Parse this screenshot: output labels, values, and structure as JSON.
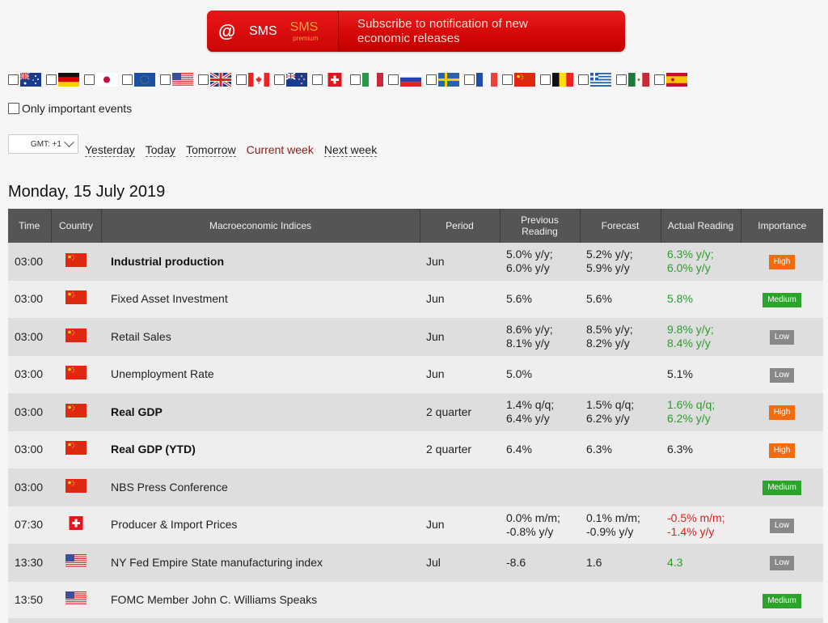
{
  "banner": {
    "email_icon": "@",
    "sms_label": "SMS",
    "sms_premium_label": "SMS",
    "sms_premium_sub": "premium",
    "text_line1": "Subscribe to notification of new",
    "text_line2": "economic releases"
  },
  "countries": [
    {
      "code": "au",
      "name": "Australia"
    },
    {
      "code": "de",
      "name": "Germany"
    },
    {
      "code": "jp",
      "name": "Japan"
    },
    {
      "code": "eu",
      "name": "European Union"
    },
    {
      "code": "us",
      "name": "United States"
    },
    {
      "code": "gb",
      "name": "United Kingdom"
    },
    {
      "code": "ca",
      "name": "Canada"
    },
    {
      "code": "nz",
      "name": "New Zealand"
    },
    {
      "code": "ch",
      "name": "Switzerland"
    },
    {
      "code": "it",
      "name": "Italy"
    },
    {
      "code": "ru",
      "name": "Russia"
    },
    {
      "code": "se",
      "name": "Sweden"
    },
    {
      "code": "fr",
      "name": "France"
    },
    {
      "code": "cn",
      "name": "China"
    },
    {
      "code": "be",
      "name": "Belgium"
    },
    {
      "code": "gr",
      "name": "Greece"
    },
    {
      "code": "mx",
      "name": "Mexico"
    },
    {
      "code": "es",
      "name": "Spain"
    }
  ],
  "filters": {
    "only_important_label": "Only important events"
  },
  "timezone": {
    "selected": "GMT: +1"
  },
  "nav": {
    "yesterday": "Yesterday",
    "today": "Today",
    "tomorrow": "Tomorrow",
    "current_week": "Current week",
    "next_week": "Next week"
  },
  "date_heading": "Monday, 15 July 2019",
  "table": {
    "headers": {
      "time": "Time",
      "country": "Country",
      "indices": "Macroeconomic Indices",
      "period": "Period",
      "previous_1": "Previous",
      "previous_2": "Reading",
      "forecast": "Forecast",
      "actual": "Actual Reading",
      "importance": "Importance"
    },
    "rows": [
      {
        "time": "03:00",
        "country": "cn",
        "event": "Industrial production",
        "bold": true,
        "period": "Jun",
        "prev": [
          "5.0% y/y;",
          "6.0% y/y"
        ],
        "forecast": [
          "5.2% y/y;",
          "5.9% y/y"
        ],
        "actual": [
          "6.3% y/y;",
          "6.0% y/y"
        ],
        "actual_color": "green",
        "importance": "High"
      },
      {
        "time": "03:00",
        "country": "cn",
        "event": "Fixed Asset Investment",
        "bold": false,
        "period": "Jun",
        "prev": [
          "5.6%"
        ],
        "forecast": [
          "5.6%"
        ],
        "actual": [
          "5.8%"
        ],
        "actual_color": "green",
        "importance": "Medium"
      },
      {
        "time": "03:00",
        "country": "cn",
        "event": "Retail Sales",
        "bold": false,
        "period": "Jun",
        "prev": [
          "8.6% y/y;",
          "8.1% y/y"
        ],
        "forecast": [
          "8.5% y/y;",
          "8.2% y/y"
        ],
        "actual": [
          "9.8% y/y;",
          "8.4% y/y"
        ],
        "actual_color": "green",
        "importance": "Low"
      },
      {
        "time": "03:00",
        "country": "cn",
        "event": "Unemployment Rate",
        "bold": false,
        "period": "Jun",
        "prev": [
          "5.0%"
        ],
        "forecast": [],
        "actual": [
          "5.1%"
        ],
        "actual_color": "neutral",
        "importance": "Low"
      },
      {
        "time": "03:00",
        "country": "cn",
        "event": "Real GDP",
        "bold": true,
        "period": "2 quarter",
        "prev": [
          "1.4% q/q;",
          "6.4% y/y"
        ],
        "forecast": [
          "1.5% q/q;",
          "6.2% y/y"
        ],
        "actual": [
          "1.6% q/q;",
          "6.2% y/y"
        ],
        "actual_color": "green",
        "importance": "High"
      },
      {
        "time": "03:00",
        "country": "cn",
        "event": "Real GDP (YTD)",
        "bold": true,
        "period": "2 quarter",
        "prev": [
          "6.4%"
        ],
        "forecast": [
          "6.3%"
        ],
        "actual": [
          "6.3%"
        ],
        "actual_color": "neutral",
        "importance": "High"
      },
      {
        "time": "03:00",
        "country": "cn",
        "event": "NBS Press Conference",
        "bold": false,
        "period": "",
        "prev": [],
        "forecast": [],
        "actual": [],
        "actual_color": "neutral",
        "importance": "Medium"
      },
      {
        "time": "07:30",
        "country": "ch",
        "event": "Producer & Import Prices",
        "bold": false,
        "period": "Jun",
        "prev": [
          "0.0% m/m;",
          "-0.8% y/y"
        ],
        "forecast": [
          "0.1% m/m;",
          "-0.9% y/y"
        ],
        "actual": [
          "-0.5% m/m;",
          "-1.4% y/y"
        ],
        "actual_color": "red",
        "importance": "Low"
      },
      {
        "time": "13:30",
        "country": "us",
        "event": "NY Fed Empire State manufacturing index",
        "bold": false,
        "period": "Jul",
        "prev": [
          "-8.6"
        ],
        "forecast": [
          "1.6"
        ],
        "actual": [
          "4.3"
        ],
        "actual_color": "green",
        "importance": "Low"
      },
      {
        "time": "13:50",
        "country": "us",
        "event": "FOMC Member John C. Williams Speaks",
        "bold": false,
        "period": "",
        "prev": [],
        "forecast": [],
        "actual": [],
        "actual_color": "neutral",
        "importance": "Medium"
      }
    ]
  }
}
